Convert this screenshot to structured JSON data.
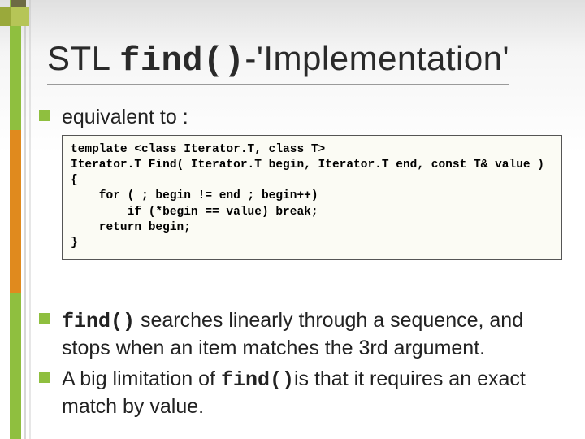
{
  "title": {
    "pre": "STL ",
    "mono": "find()",
    "post": "-'Implementation'"
  },
  "bullets": {
    "b1": {
      "text": "equivalent to :"
    },
    "b2": {
      "mono": "find()",
      "rest1": " searches linearly through a sequence, and stops when an item matches the 3rd argument."
    },
    "b3": {
      "pre": "A big limitation of ",
      "mono": "find()",
      "post": "is that it requires an exact match by value."
    }
  },
  "code": "template <class Iterator.T, class T>\nIterator.T Find( Iterator.T begin, Iterator.T end, const T& value )\n{\n    for ( ; begin != end ; begin++)\n        if (*begin == value) break;\n    return begin;\n}"
}
